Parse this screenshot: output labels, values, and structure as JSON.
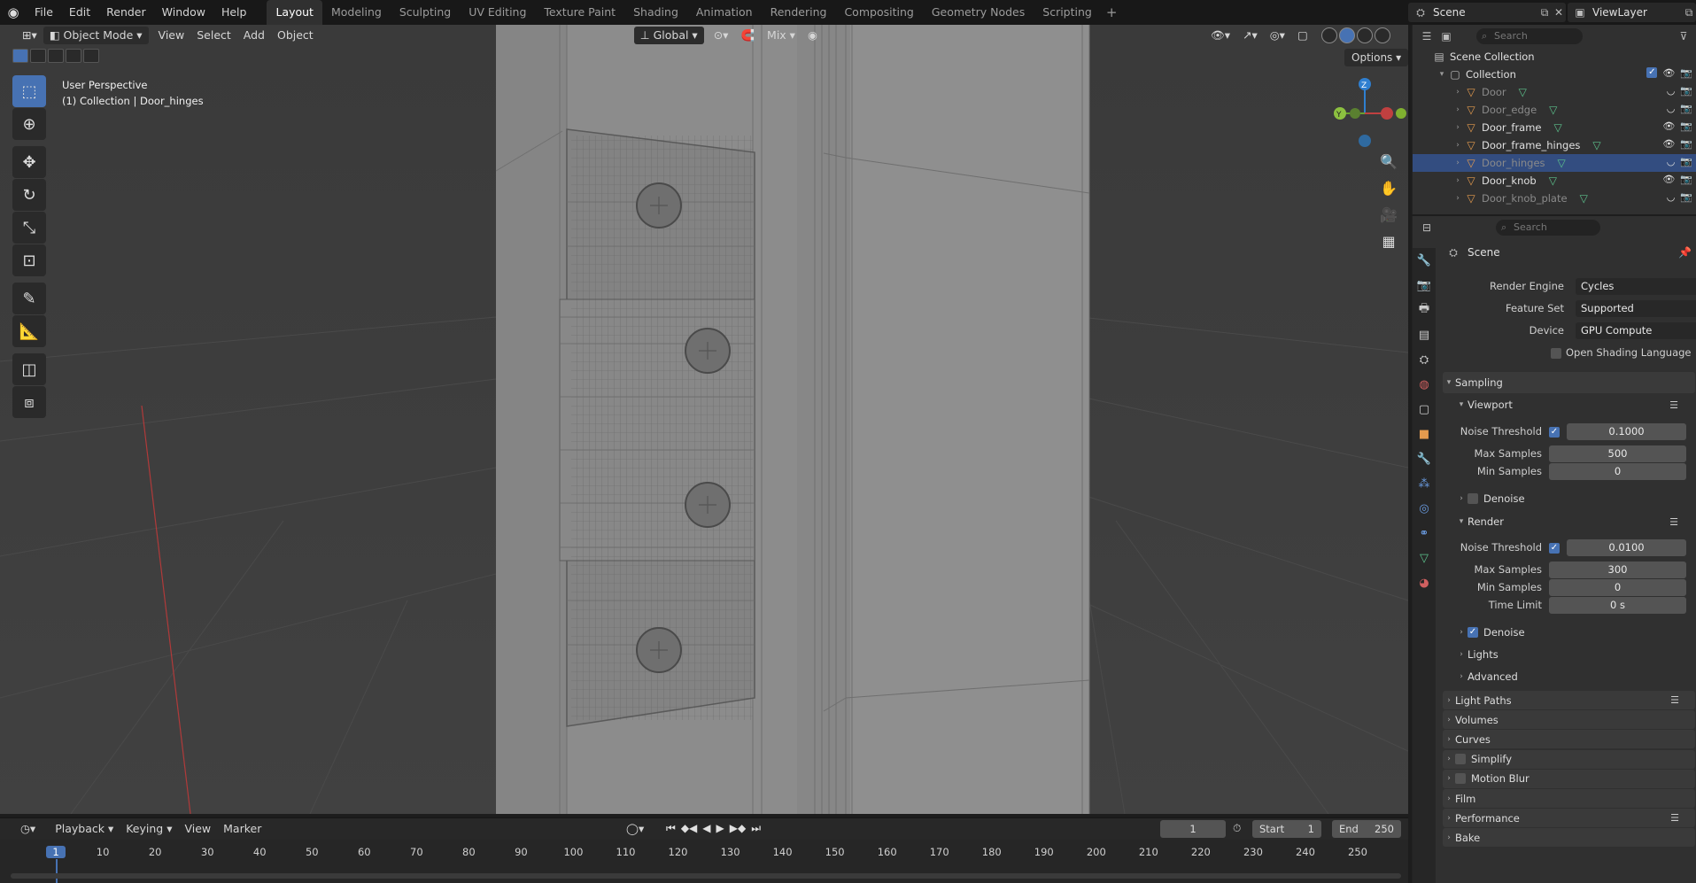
{
  "topbar": {
    "menus": [
      "File",
      "Edit",
      "Render",
      "Window",
      "Help"
    ],
    "workspaces": [
      "Layout",
      "Modeling",
      "Sculpting",
      "UV Editing",
      "Texture Paint",
      "Shading",
      "Animation",
      "Rendering",
      "Compositing",
      "Geometry Nodes",
      "Scripting"
    ],
    "active_workspace": "Layout",
    "scene_name": "Scene",
    "view_layer": "ViewLayer"
  },
  "viewport": {
    "mode": "Object Mode",
    "menus": [
      "View",
      "Select",
      "Add",
      "Object"
    ],
    "orientation": "Global",
    "snap_label": "Mix",
    "options_label": "Options",
    "perspective_label": "User Perspective",
    "collection_label": "(1) Collection | Door_hinges"
  },
  "outliner": {
    "search_placeholder": "Search",
    "scene_collection": "Scene Collection",
    "collection": "Collection",
    "objects": [
      {
        "name": "Door",
        "dim": true,
        "selected": false
      },
      {
        "name": "Door_edge",
        "dim": true,
        "selected": false
      },
      {
        "name": "Door_frame",
        "dim": false,
        "selected": false
      },
      {
        "name": "Door_frame_hinges",
        "dim": false,
        "selected": false
      },
      {
        "name": "Door_hinges",
        "dim": true,
        "selected": true
      },
      {
        "name": "Door_knob",
        "dim": false,
        "selected": false
      },
      {
        "name": "Door_knob_plate",
        "dim": true,
        "selected": false
      }
    ]
  },
  "properties": {
    "search_placeholder": "Search",
    "context": "Scene",
    "render_engine_label": "Render Engine",
    "render_engine": "Cycles",
    "feature_set_label": "Feature Set",
    "feature_set": "Supported",
    "device_label": "Device",
    "device": "GPU Compute",
    "osl_label": "Open Shading Language",
    "sampling": "Sampling",
    "viewport_section": "Viewport",
    "noise_threshold_label": "Noise Threshold",
    "viewport_noise": "0.1000",
    "max_samples_label": "Max Samples",
    "viewport_max": "500",
    "min_samples_label": "Min Samples",
    "viewport_min": "0",
    "denoise_label": "Denoise",
    "render_section": "Render",
    "render_noise": "0.0100",
    "render_max": "300",
    "render_min": "0",
    "time_limit_label": "Time Limit",
    "time_limit": "0 s",
    "lights": "Lights",
    "advanced": "Advanced",
    "panels": [
      "Light Paths",
      "Volumes",
      "Curves",
      "Simplify",
      "Motion Blur",
      "Film",
      "Performance",
      "Bake"
    ]
  },
  "timeline": {
    "menus": [
      "Playback",
      "Keying",
      "View",
      "Marker"
    ],
    "current_frame": "1",
    "start_label": "Start",
    "start": "1",
    "end_label": "End",
    "end": "250",
    "ticks": [
      "1",
      "10",
      "20",
      "30",
      "40",
      "50",
      "60",
      "70",
      "80",
      "90",
      "100",
      "110",
      "120",
      "130",
      "140",
      "150",
      "160",
      "170",
      "180",
      "190",
      "200",
      "210",
      "220",
      "230",
      "240",
      "250"
    ]
  },
  "colors": {
    "accent": "#4772b3",
    "selection": "#334d80",
    "object_orange": "#e39a4e",
    "mesh_green": "#5cc18c"
  }
}
